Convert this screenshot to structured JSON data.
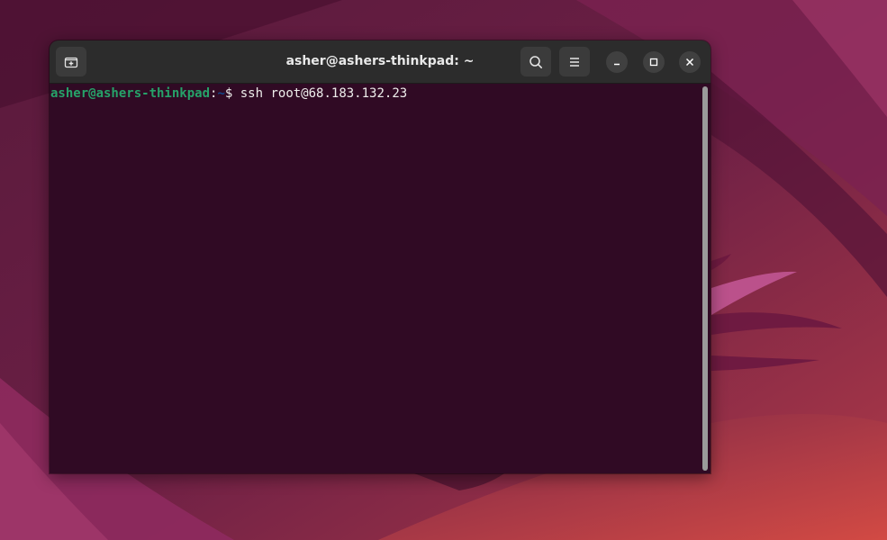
{
  "window": {
    "title": "asher@ashers-thinkpad: ~"
  },
  "headerbar": {
    "new_tab_icon": "new-tab-icon",
    "search_icon": "search-icon",
    "menu_icon": "hamburger-menu-icon",
    "minimize_icon": "minimize-icon",
    "maximize_icon": "maximize-icon",
    "close_icon": "close-icon"
  },
  "terminal": {
    "prompt_user_host": "asher@ashers-thinkpad",
    "prompt_separator": ":",
    "prompt_path": "~",
    "prompt_symbol": "$ ",
    "command": "ssh root@68.183.132.23"
  },
  "colors": {
    "terminal_background": "#300a24",
    "prompt_user": "#26a269",
    "prompt_path": "#12488b",
    "headerbar": "#2c2c2c"
  }
}
